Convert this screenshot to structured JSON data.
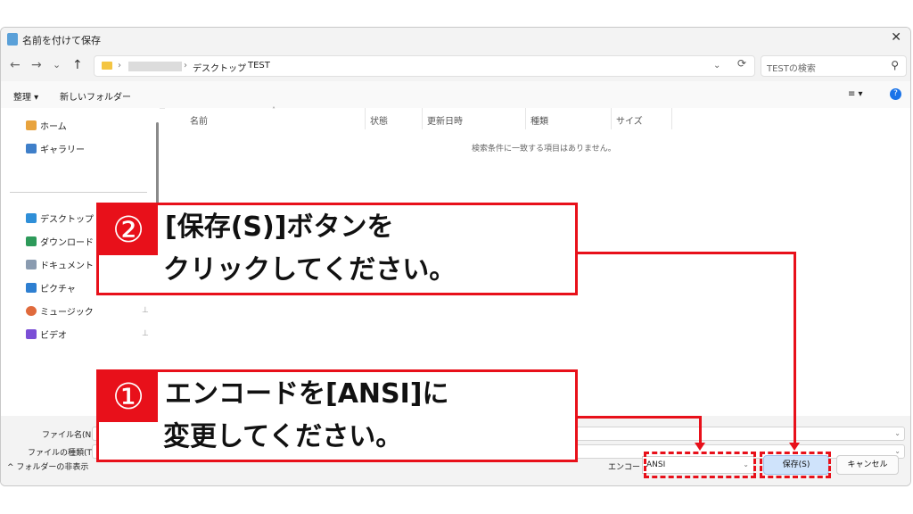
{
  "window": {
    "title": "名前を付けて保存",
    "close": "✕"
  },
  "nav": {
    "back": "←",
    "forward": "→",
    "recent": "⌄",
    "up": "↑",
    "sep1": "›",
    "breadcrumb": [
      "デスクトップ",
      "TEST"
    ],
    "sep2": "›",
    "sep3": "›",
    "dropdown": "⌄",
    "refresh": "⟳",
    "search_placeholder": "TESTの検索"
  },
  "toolbar": {
    "organize": "整理 ▾",
    "new_folder": "新しいフォルダー",
    "view": "≡ ▾",
    "help": "?"
  },
  "sidebar": {
    "quick": [
      {
        "label": "ホーム",
        "color": "#e8a33d"
      },
      {
        "label": "ギャラリー",
        "color": "#3f7fc9"
      }
    ],
    "folders": [
      {
        "label": "デスクトップ",
        "color": "#2f8fd8",
        "pinned": false
      },
      {
        "label": "ダウンロード",
        "color": "#2d9a5a",
        "pinned": false
      },
      {
        "label": "ドキュメント",
        "color": "#8a9bb0",
        "pinned": false
      },
      {
        "label": "ピクチャ",
        "color": "#2e7fd1",
        "pinned": false
      },
      {
        "label": "ミュージック",
        "color": "#e06a3c",
        "pinned": true
      },
      {
        "label": "ビデオ",
        "color": "#7b4fd6",
        "pinned": true
      }
    ],
    "pin_glyph": "📌"
  },
  "content": {
    "columns": [
      "名前",
      "状態",
      "更新日時",
      "種類",
      "サイズ"
    ],
    "empty_message": "検索条件に一致する項目はありません。"
  },
  "bottom": {
    "filename_label": "ファイル名(N):",
    "filename_value": "",
    "filetype_label": "ファイルの種類(T):",
    "filetype_value": "",
    "hide_folders": "^ フォルダーの非表示",
    "encoding_label": "エンコード:",
    "encoding_value": "ANSI",
    "save_label": "保存(S)",
    "cancel_label": "キャンセル"
  },
  "callouts": {
    "step2": {
      "number": "②",
      "line1": "[保存(S)]ボタンを",
      "line2": "クリックしてください。"
    },
    "step1": {
      "number": "①",
      "line1": "エンコードを[ANSI]に",
      "line2": "変更してください。"
    }
  },
  "colors": {
    "accent_red": "#e8101a",
    "primary_button": "#cfe3fb"
  }
}
